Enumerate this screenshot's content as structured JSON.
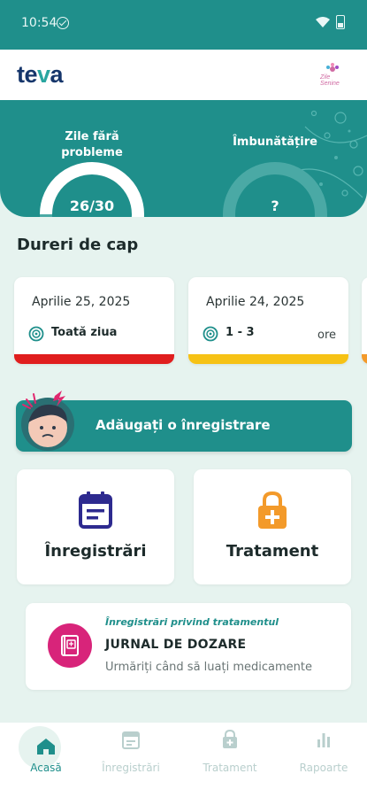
{
  "status_bar": {
    "time": "10:54"
  },
  "header": {
    "logo_prefix": "te",
    "logo_accent": "v",
    "logo_suffix": "a",
    "partner_logo_text": "Zile Senine"
  },
  "hero": {
    "metrics": [
      {
        "label_line1": "Zile fără",
        "label_line2": "probleme",
        "value": "26/30",
        "progress": 0.867
      },
      {
        "label_line1": "Îmbunătățire",
        "label_line2": "",
        "value": "?",
        "progress": 0
      }
    ]
  },
  "section_title": "Dureri de cap",
  "entries": [
    {
      "date": "Aprilie 25, 2025",
      "duration": "Toată ziua",
      "unit": "",
      "severity_color": "#e01e1e"
    },
    {
      "date": "Aprilie 24, 2025",
      "duration": "1 - 3",
      "unit": "ore",
      "severity_color": "#f6c215"
    }
  ],
  "add_button": {
    "label": "Adăugați o înregistrare"
  },
  "tiles": [
    {
      "label": "Înregistrări",
      "icon": "calendar-icon"
    },
    {
      "label": "Tratament",
      "icon": "medicine-lock-icon"
    }
  ],
  "journal": {
    "kicker": "Înregistrări privind tratamentul",
    "title": "JURNAL DE DOZARE",
    "subtitle": "Urmăriți când să luați medicamente"
  },
  "bottom_nav": {
    "items": [
      {
        "label": "Acasă",
        "active": true
      },
      {
        "label": "Înregistrări",
        "active": false
      },
      {
        "label": "Tratament",
        "active": false
      },
      {
        "label": "Rapoarte",
        "active": false
      }
    ]
  },
  "colors": {
    "accent": "#1f8f8b",
    "brand_navy": "#16366b",
    "pink": "#d8247a",
    "icon_navy": "#2d2a8f",
    "icon_orange": "#f39a2a"
  }
}
